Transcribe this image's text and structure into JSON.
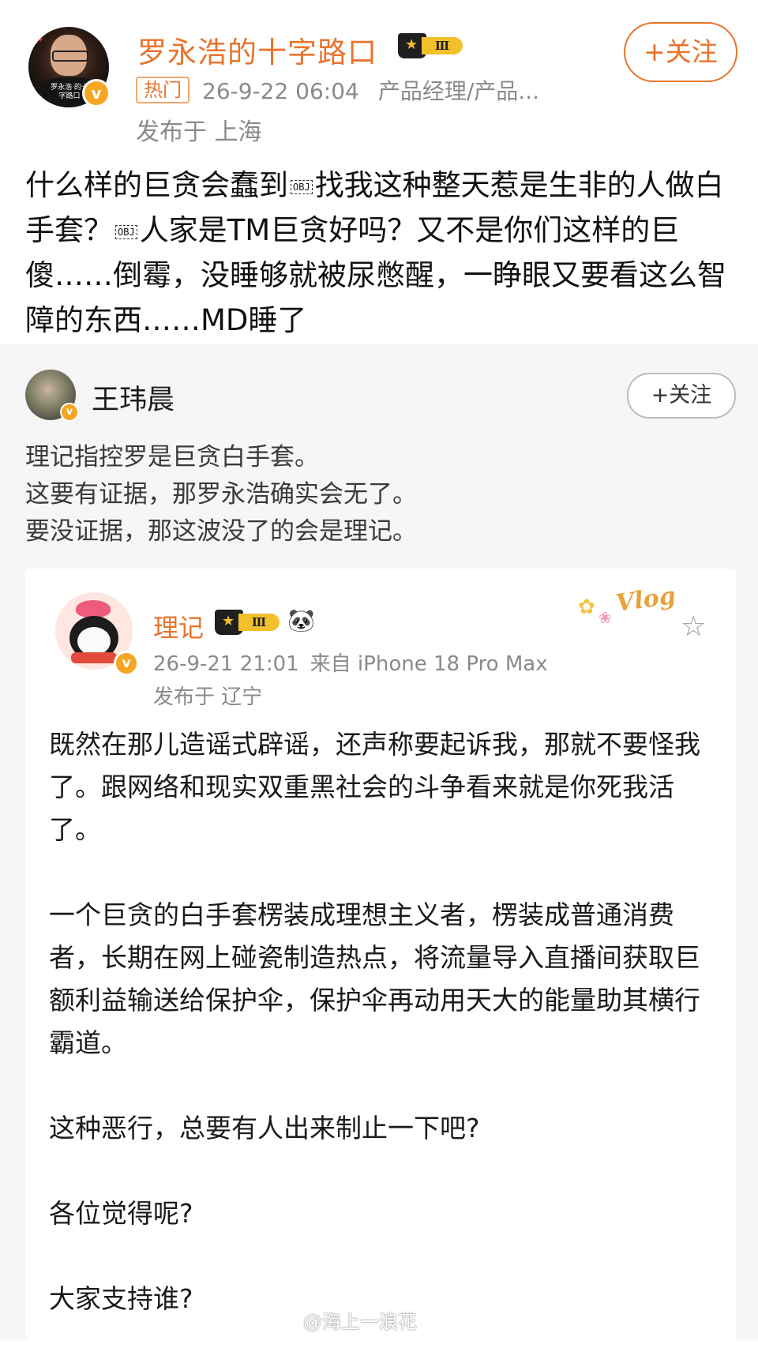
{
  "post": {
    "author": "罗永浩的十字路口",
    "level_badge": "Ⅲ",
    "hot_tag": "热门",
    "datetime": "26-9-22 06:04",
    "category": "产品经理/产品...",
    "location": "发布于 上海",
    "follow_label": "+关注",
    "avatar_caption": "罗永浩 的十字路口",
    "text_part1": "什么样的巨贪会蠢到",
    "obj_marker": "OBJ",
    "text_part2": "找我这种整天惹是生非的人做白手套？",
    "text_part3": "人家是TM巨贪好吗？又不是你们这样的巨傻……倒霉，没睡够就被尿憋醒，一睁眼又要看这么智障的东西……MD睡了",
    "verified_badge": "v"
  },
  "repost": {
    "author": "王玮晨",
    "follow_label": "+关注",
    "verified_badge": "v",
    "lines": [
      "理记指控罗是巨贪白手套。",
      "这要有证据，那罗永浩确实会无了。",
      "要没证据，那这波没了的会是理记。"
    ]
  },
  "quoted": {
    "author": "理记",
    "level_badge": "Ⅲ",
    "panda": "🐼",
    "datetime": "26-9-21 21:01",
    "source": "来自 iPhone 18 Pro Max",
    "location": "发布于 辽宁",
    "sticker_text": "Vlog",
    "verified_badge": "v",
    "star_icon": "☆",
    "paragraphs": [
      "既然在那儿造谣式辟谣，还声称要起诉我，那就不要怪我了。跟网络和现实双重黑社会的斗争看来就是你死我活了。",
      "一个巨贪的白手套楞装成理想主义者，楞装成普通消费者，长期在网上碰瓷制造热点，将流量导入直播间获取巨额利益输送给保护伞，保护伞再动用天大的能量助其横行霸道。",
      "这种恶行，总要有人出来制止一下吧?",
      "各位觉得呢?",
      "大家支持谁?"
    ]
  },
  "watermark": "@海上一浪花"
}
